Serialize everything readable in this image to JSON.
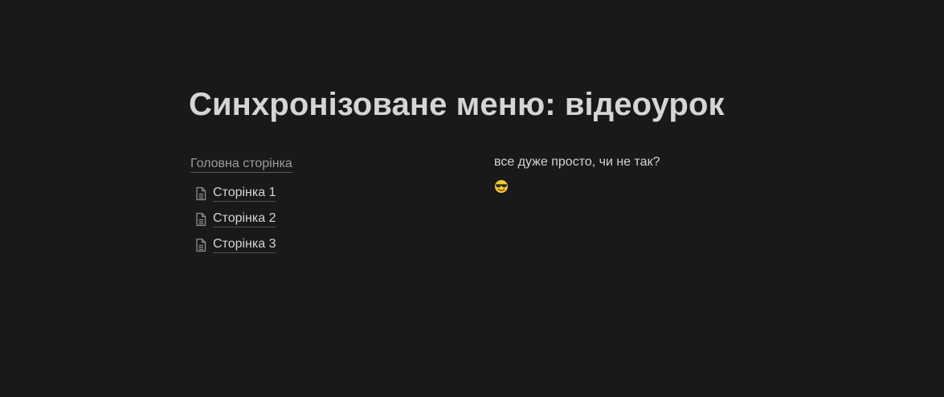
{
  "title": "Синхронізоване меню: відеоурок",
  "left": {
    "home_link": "Головна сторінка",
    "pages": [
      {
        "icon": "page-icon",
        "label": "Сторінка 1"
      },
      {
        "icon": "page-icon",
        "label": "Сторінка 2"
      },
      {
        "icon": "page-icon",
        "label": "Сторінка 3"
      }
    ]
  },
  "right": {
    "text": "все дуже просто, чи не так?",
    "emoji": "smiling-face-with-sunglasses-icon"
  }
}
